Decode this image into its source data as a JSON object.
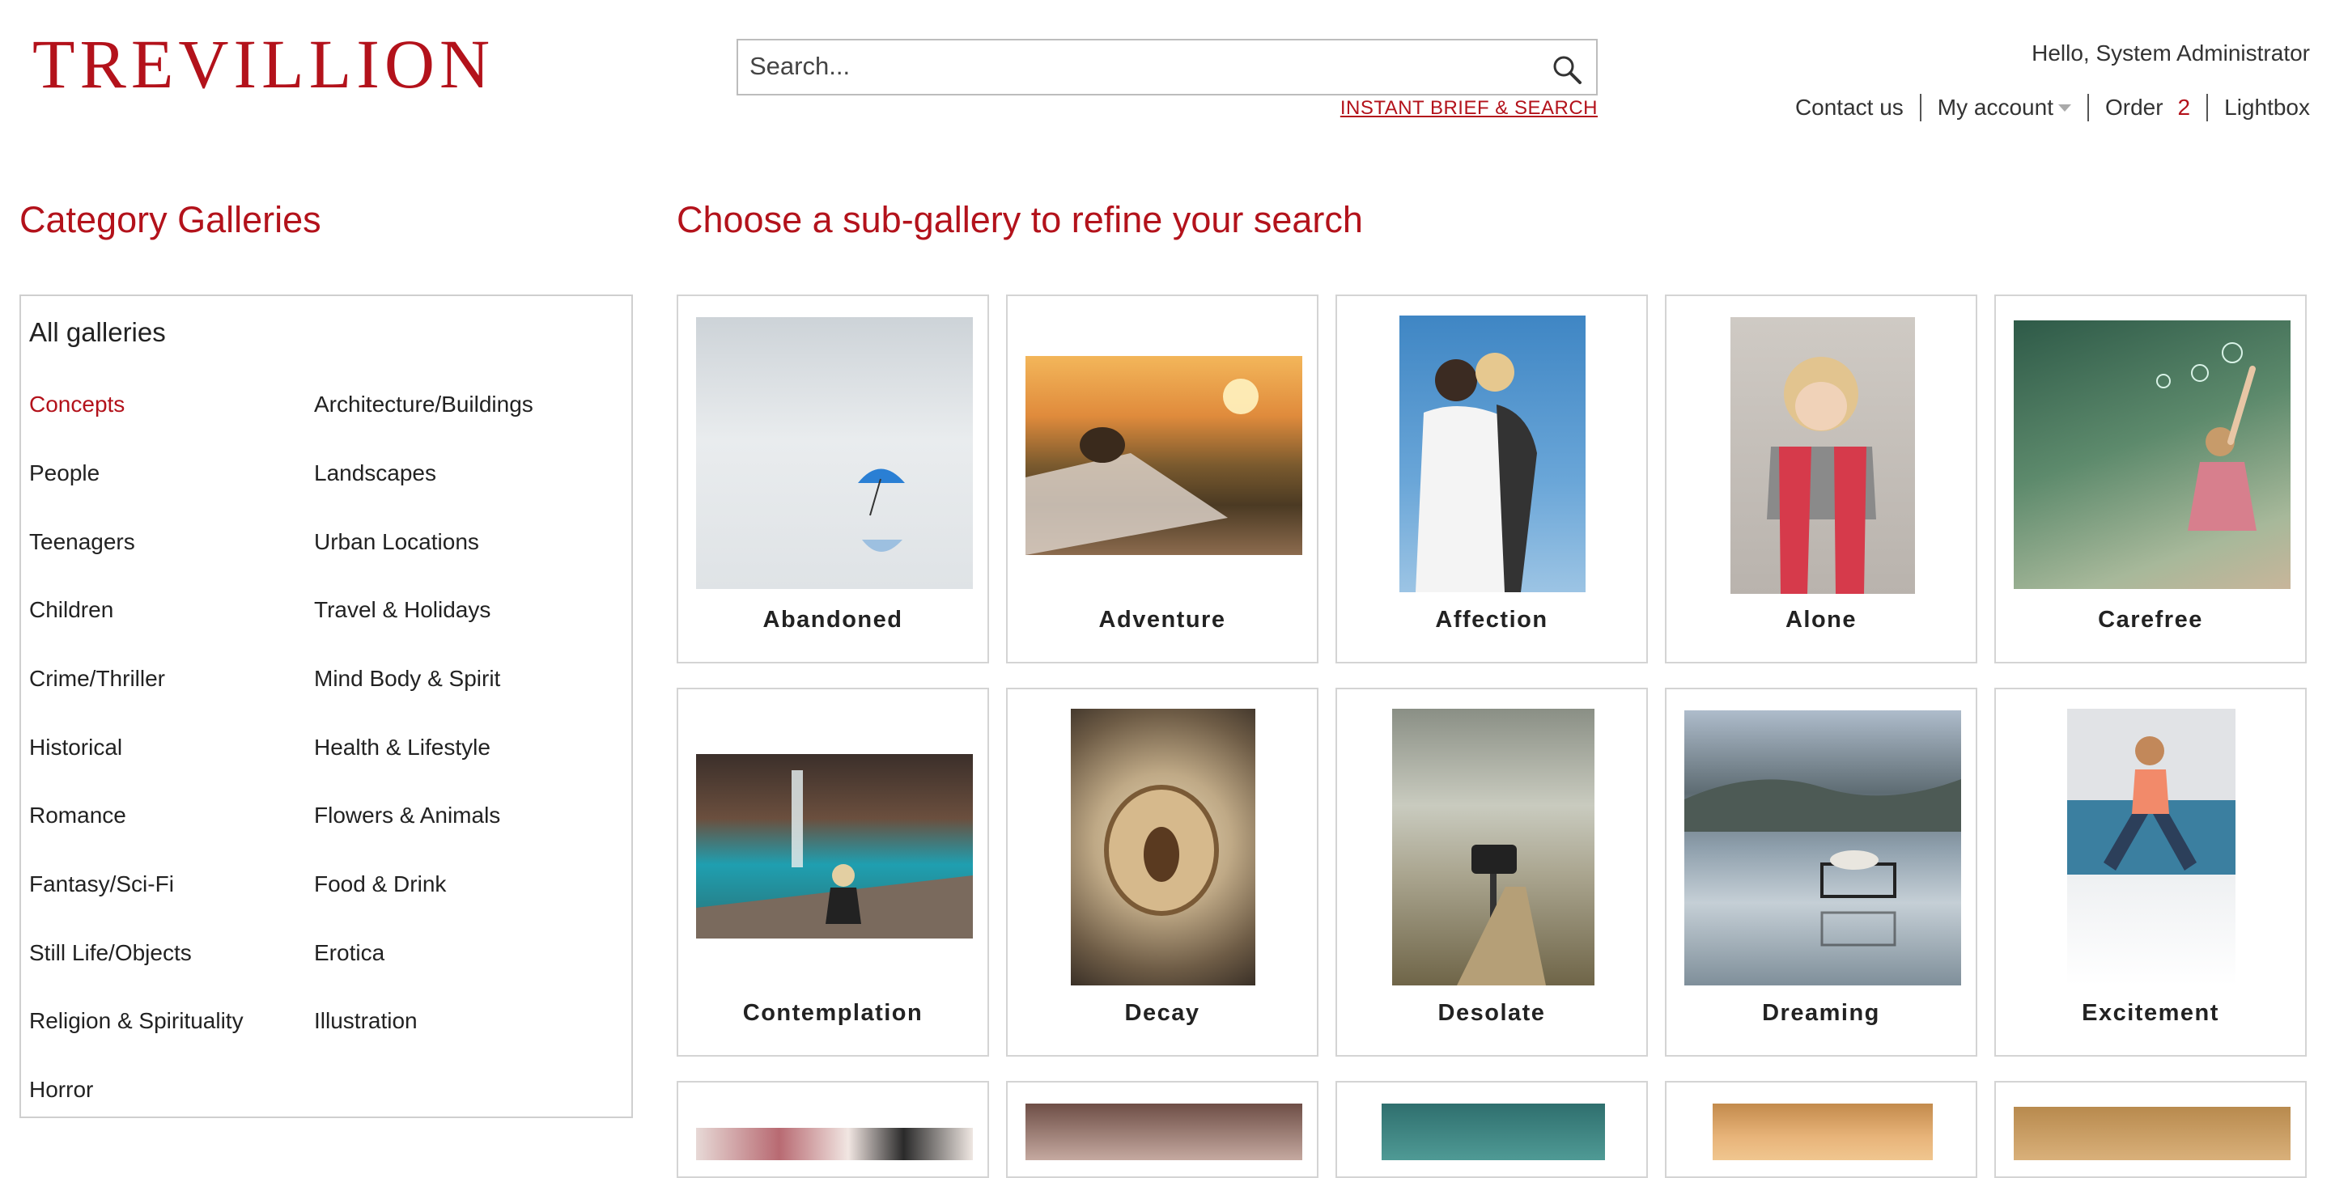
{
  "header": {
    "logo_text": "TREVILLION",
    "search_placeholder": "Search...",
    "instant_brief_link": "INSTANT BRIEF & SEARCH",
    "greeting": "Hello, System Administrator",
    "nav": {
      "contact": "Contact us",
      "account": "My account",
      "order": "Order",
      "order_count": "2",
      "lightbox": "Lightbox"
    }
  },
  "sidebar": {
    "heading": "Category Galleries",
    "all_label": "All galleries",
    "col1": [
      "Concepts",
      "People",
      "Teenagers",
      "Children",
      "Crime/Thriller",
      "Historical",
      "Romance",
      "Fantasy/Sci-Fi",
      "Still Life/Objects",
      "Religion & Spirituality",
      "Horror"
    ],
    "col2": [
      "Architecture/Buildings",
      "Landscapes",
      "Urban Locations",
      "Travel & Holidays",
      "Mind Body & Spirit",
      "Health & Lifestyle",
      "Flowers & Animals",
      "Food & Drink",
      "Erotica",
      "Illustration"
    ],
    "active": "Concepts"
  },
  "main": {
    "heading": "Choose a sub-gallery to refine your search",
    "tiles": [
      {
        "label": "Abandoned"
      },
      {
        "label": "Adventure"
      },
      {
        "label": "Affection"
      },
      {
        "label": "Alone"
      },
      {
        "label": "Carefree"
      },
      {
        "label": "Contemplation"
      },
      {
        "label": "Decay"
      },
      {
        "label": "Desolate"
      },
      {
        "label": "Dreaming"
      },
      {
        "label": "Excitement"
      }
    ]
  },
  "colors": {
    "brand": "#b3121b",
    "border": "#d4d4d4"
  }
}
